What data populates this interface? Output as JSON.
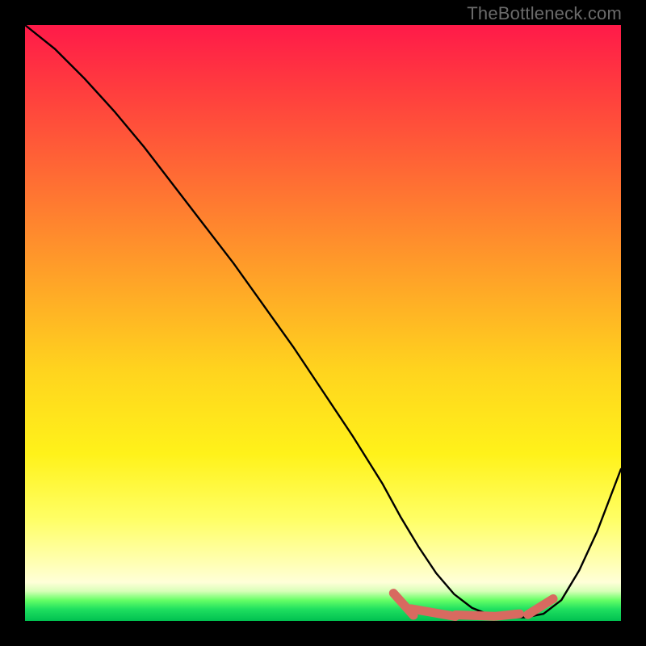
{
  "watermark": "TheBottleneck.com",
  "chart_data": {
    "type": "line",
    "title": "",
    "xlabel": "",
    "ylabel": "",
    "xlim": [
      0,
      100
    ],
    "ylim": [
      0,
      100
    ],
    "grid": false,
    "series": [
      {
        "name": "bottleneck-curve",
        "x": [
          0,
          5,
          10,
          15,
          20,
          25,
          30,
          35,
          40,
          45,
          50,
          55,
          60,
          63,
          66,
          69,
          72,
          75,
          78,
          81,
          84,
          87,
          90,
          93,
          96,
          100
        ],
        "y": [
          100,
          96,
          91,
          85.5,
          79.5,
          73,
          66.5,
          60,
          53,
          46,
          38.5,
          31,
          23,
          17.5,
          12.5,
          8,
          4.5,
          2.2,
          1.0,
          0.6,
          0.6,
          1.2,
          3.5,
          8.5,
          15,
          25.5
        ]
      }
    ],
    "markers": {
      "name": "highlight-dashes",
      "color": "#d86a60",
      "points": [
        {
          "x": 63.5,
          "y": 2.8,
          "len": 5.0,
          "angle": -48
        },
        {
          "x": 68.5,
          "y": 1.4,
          "len": 7.5,
          "angle": -10
        },
        {
          "x": 75.5,
          "y": 0.9,
          "len": 6.5,
          "angle": -2
        },
        {
          "x": 81.0,
          "y": 1.0,
          "len": 4.0,
          "angle": 6
        },
        {
          "x": 86.5,
          "y": 2.4,
          "len": 5.0,
          "angle": 32
        }
      ]
    },
    "gradient_stops": [
      {
        "pos": 0,
        "color": "#ff1a49"
      },
      {
        "pos": 0.25,
        "color": "#ff6a34"
      },
      {
        "pos": 0.58,
        "color": "#ffd41e"
      },
      {
        "pos": 0.9,
        "color": "#ffffb0"
      },
      {
        "pos": 0.97,
        "color": "#40e860"
      },
      {
        "pos": 1.0,
        "color": "#00c050"
      }
    ]
  }
}
